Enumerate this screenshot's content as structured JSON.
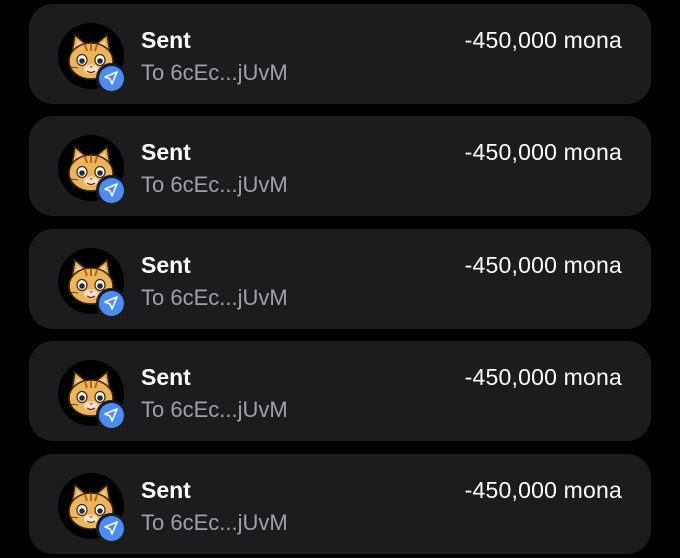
{
  "colors": {
    "background": "#000000",
    "card": "#1c1c1e",
    "badge": "#4d8cf5",
    "title": "#ffffff",
    "subtitle": "#a0a0a5"
  },
  "transactions": [
    {
      "title": "Sent",
      "subtitle": "To 6cEc...jUvM",
      "amount": "-450,000 mona",
      "avatar_icon": "cat-face-icon",
      "badge_icon": "send-arrow-icon"
    },
    {
      "title": "Sent",
      "subtitle": "To 6cEc...jUvM",
      "amount": "-450,000 mona",
      "avatar_icon": "cat-face-icon",
      "badge_icon": "send-arrow-icon"
    },
    {
      "title": "Sent",
      "subtitle": "To 6cEc...jUvM",
      "amount": "-450,000 mona",
      "avatar_icon": "cat-face-icon",
      "badge_icon": "send-arrow-icon"
    },
    {
      "title": "Sent",
      "subtitle": "To 6cEc...jUvM",
      "amount": "-450,000 mona",
      "avatar_icon": "cat-face-icon",
      "badge_icon": "send-arrow-icon"
    },
    {
      "title": "Sent",
      "subtitle": "To 6cEc...jUvM",
      "amount": "-450,000 mona",
      "avatar_icon": "cat-face-icon",
      "badge_icon": "send-arrow-icon"
    }
  ]
}
